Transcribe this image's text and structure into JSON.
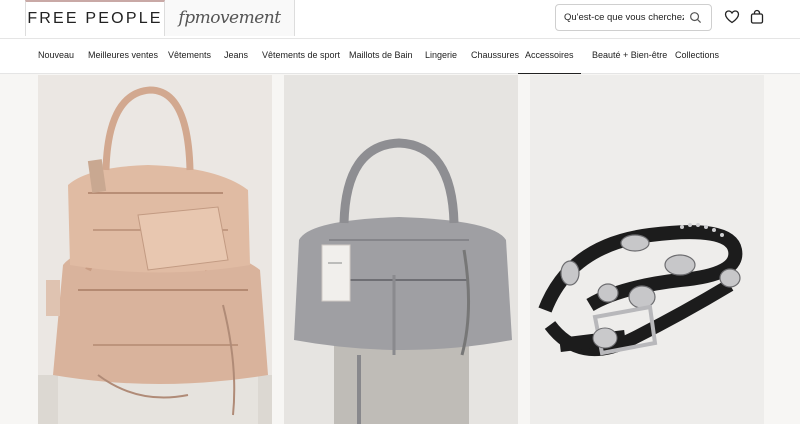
{
  "header": {
    "brand": "FREE PEOPLE",
    "secondary_brand": "fpmovement",
    "search": {
      "placeholder": "Qu'est-ce que vous cherchez?"
    },
    "icons": [
      "search-icon",
      "heart-icon",
      "bag-icon"
    ]
  },
  "nav": {
    "items": [
      "Nouveau",
      "Meilleures ventes",
      "Vêtements",
      "Jeans",
      "Vêtements de sport",
      "Maillots de Bain",
      "Lingerie",
      "Chaussures",
      "Accessoires",
      "Beauté + Bien-être",
      "Collections"
    ],
    "active_index": 8
  },
  "products": [
    {
      "name": "product-tan-leather-bags"
    },
    {
      "name": "product-grey-leather-bag"
    },
    {
      "name": "product-black-western-belt"
    }
  ],
  "colors": {
    "accent_tab": "#c9a9a6",
    "background": "#f7f6f4"
  }
}
